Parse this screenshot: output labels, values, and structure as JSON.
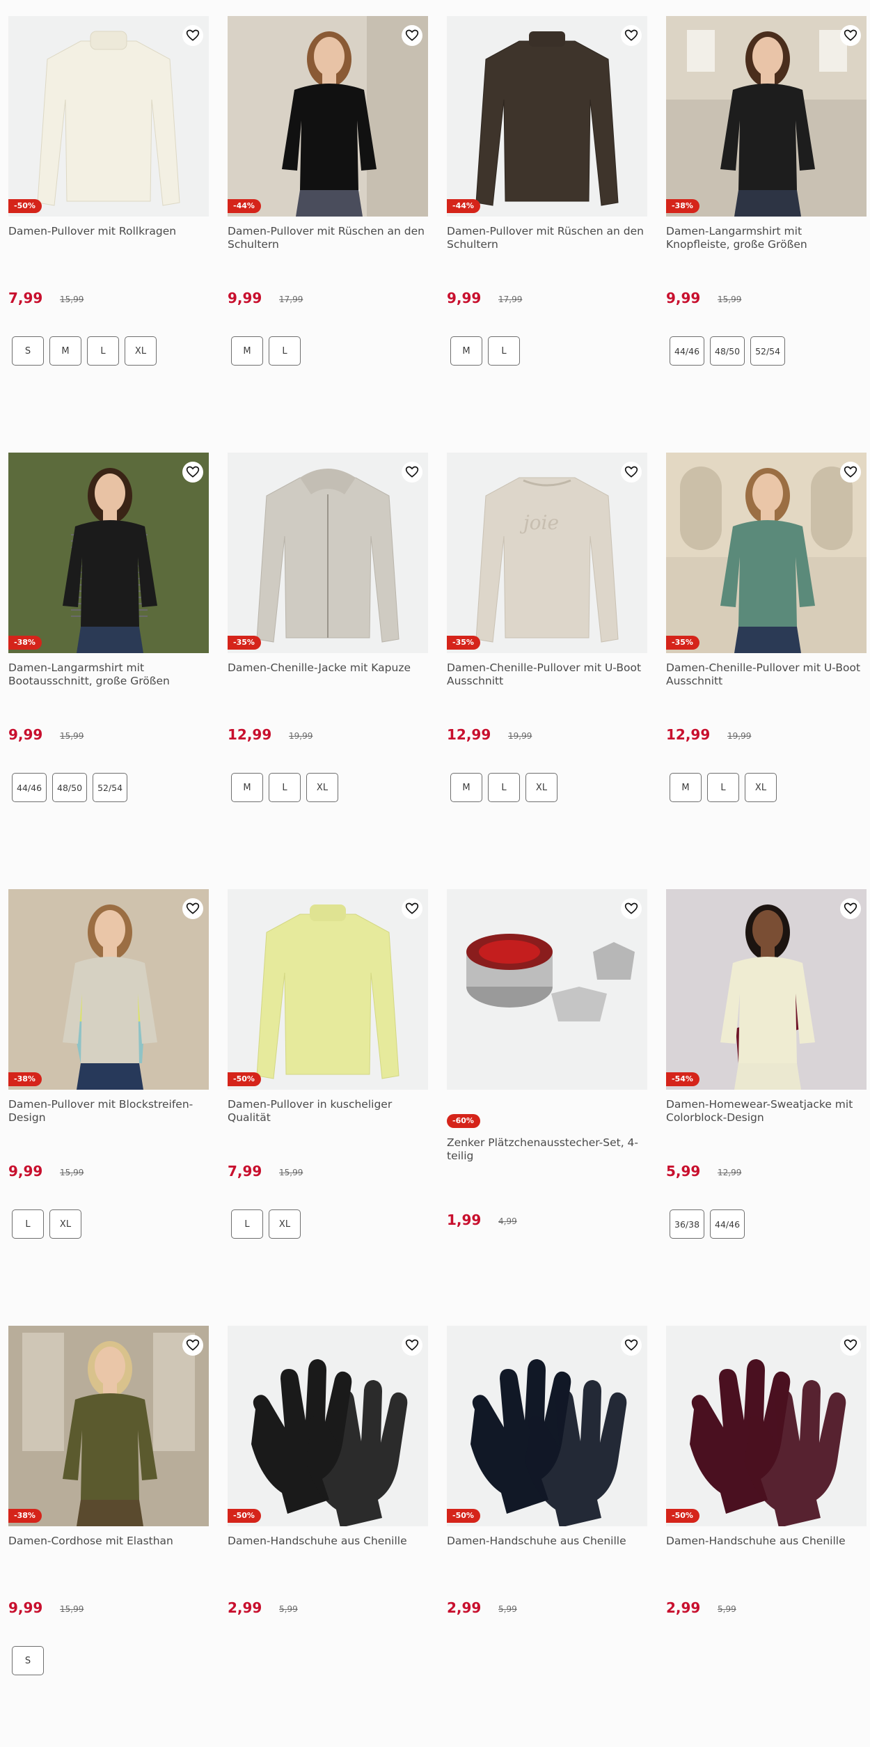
{
  "colors": {
    "sale_red": "#c8102e",
    "badge_red": "#d5241a",
    "border": "#6f6f6f"
  },
  "products": [
    {
      "title": "Damen-Pullover mit Rollkragen",
      "price": "7,99",
      "old_price": "15,99",
      "discount": "-50%",
      "sizes": [
        "S",
        "M",
        "L",
        "XL"
      ],
      "image": "cream-turtleneck"
    },
    {
      "title": "Damen-Pullover mit Rüschen an den Schultern",
      "price": "9,99",
      "old_price": "17,99",
      "discount": "-44%",
      "sizes": [
        "M",
        "L"
      ],
      "image": "model-black-sweater"
    },
    {
      "title": "Damen-Pullover mit Rüschen an den Schultern",
      "price": "9,99",
      "old_price": "17,99",
      "discount": "-44%",
      "sizes": [
        "M",
        "L"
      ],
      "image": "brown-sweater"
    },
    {
      "title": "Damen-Langarmshirt mit Knopfleiste, große Größen",
      "price": "9,99",
      "old_price": "15,99",
      "discount": "-38%",
      "sizes": [
        "44/46",
        "48/50",
        "52/54"
      ],
      "image": "model-black-shirt"
    },
    {
      "title": "Damen-Langarmshirt mit Bootausschnitt, große Größen",
      "price": "9,99",
      "old_price": "15,99",
      "discount": "-38%",
      "sizes": [
        "44/46",
        "48/50",
        "52/54"
      ],
      "image": "model-striped-shirt"
    },
    {
      "title": "Damen-Chenille-Jacke mit Kapuze",
      "price": "12,99",
      "old_price": "19,99",
      "discount": "-35%",
      "sizes": [
        "M",
        "L",
        "XL"
      ],
      "image": "beige-hoodie-jacket"
    },
    {
      "title": "Damen-Chenille-Pullover mit U-Boot Ausschnitt",
      "price": "12,99",
      "old_price": "19,99",
      "discount": "-35%",
      "sizes": [
        "M",
        "L",
        "XL"
      ],
      "image": "beige-sweater"
    },
    {
      "title": "Damen-Chenille-Pullover mit U-Boot Ausschnitt",
      "price": "12,99",
      "old_price": "19,99",
      "discount": "-35%",
      "sizes": [
        "M",
        "L",
        "XL"
      ],
      "image": "model-green-sweater"
    },
    {
      "title": "Damen-Pullover mit Blockstreifen-Design",
      "price": "9,99",
      "old_price": "15,99",
      "discount": "-38%",
      "sizes": [
        "L",
        "XL"
      ],
      "image": "model-stripe-block-sweater"
    },
    {
      "title": "Damen-Pullover in kuscheliger Qualität",
      "price": "7,99",
      "old_price": "15,99",
      "discount": "-50%",
      "sizes": [
        "L",
        "XL"
      ],
      "image": "yellow-sweater"
    },
    {
      "title": "Zenker Plätzchenausstecher-Set, 4-teilig",
      "price": "1,99",
      "old_price": "4,99",
      "discount": "-60%",
      "sizes": [],
      "image": "cookie-cutters"
    },
    {
      "title": "Damen-Homewear-Sweatjacke mit Colorblock-Design",
      "price": "5,99",
      "old_price": "12,99",
      "discount": "-54%",
      "sizes": [
        "36/38",
        "44/46"
      ],
      "image": "model-colorblock-jacket"
    },
    {
      "title": "Damen-Cordhose mit Elasthan",
      "price": "9,99",
      "old_price": "15,99",
      "discount": "-38%",
      "sizes": [
        "S"
      ],
      "image": "model-olive-vest"
    },
    {
      "title": "Damen-Handschuhe aus Chenille",
      "price": "2,99",
      "old_price": "5,99",
      "discount": "-50%",
      "sizes": [],
      "image": "black-gloves"
    },
    {
      "title": "Damen-Handschuhe aus Chenille",
      "price": "2,99",
      "old_price": "5,99",
      "discount": "-50%",
      "sizes": [],
      "image": "navy-gloves"
    },
    {
      "title": "Damen-Handschuhe aus Chenille",
      "price": "2,99",
      "old_price": "5,99",
      "discount": "-50%",
      "sizes": [],
      "image": "burgundy-gloves"
    }
  ]
}
